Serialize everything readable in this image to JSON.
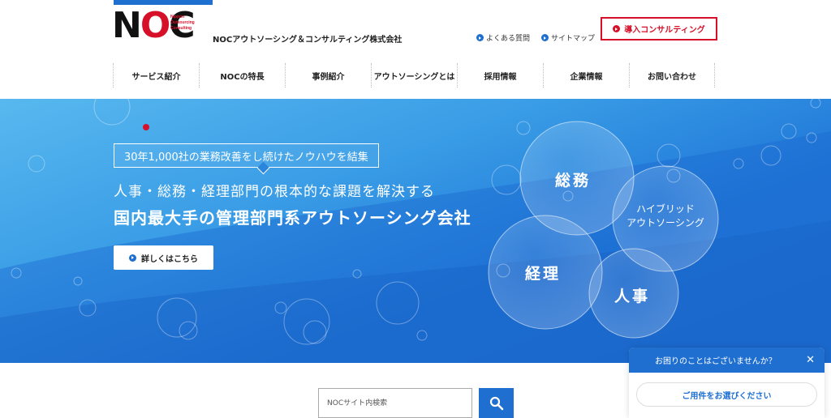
{
  "logo": {
    "letters": "NOC",
    "sub": [
      "Nippon",
      "Outsourcing",
      "Consulting"
    ]
  },
  "header": {
    "company_name": "NOCアウトソーシング＆コンサルティング株式会社",
    "utility_links": [
      "よくある質問",
      "サイトマップ"
    ],
    "consult_button": "導入コンサルティング"
  },
  "nav": {
    "items": [
      "サービス紹介",
      "NOCの特長",
      "事例紹介",
      "アウトソーシングとは",
      "採用情報",
      "企業情報",
      "お問い合わせ"
    ]
  },
  "hero": {
    "tagline": "30年1,000社の業務改善をし続けたノウハウを結集",
    "line1": "人事・総務・経理部門の根本的な課題を解決する",
    "line2": "国内最大手の管理部門系アウトソーシング会社",
    "detail_button": "詳しくはこちら",
    "bubbles": {
      "soumu": "総務",
      "hybrid_line1": "ハイブリッド",
      "hybrid_line2": "アウトソーシング",
      "keiri": "経理",
      "jinji": "人事"
    }
  },
  "search": {
    "placeholder": "NOCサイト内検索"
  },
  "chat": {
    "header": "お困りのことはございませんか？",
    "select_label": "ご用件をお選びください"
  },
  "colors": {
    "brand_blue": "#1f6fd1",
    "brand_red": "#d7102a"
  }
}
